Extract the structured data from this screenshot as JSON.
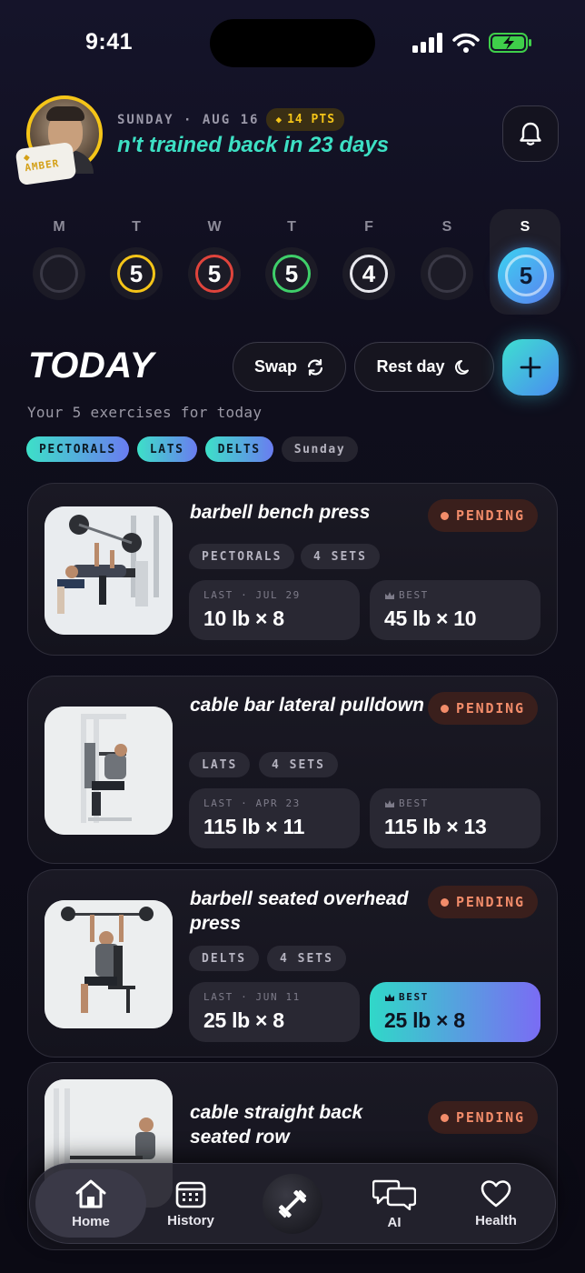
{
  "status": {
    "time": "9:41"
  },
  "header": {
    "avatar_badge": "AMBER",
    "date": "SUNDAY · AUG 16",
    "points": "14 PTS",
    "streak_message": "n't trained back in 23 days"
  },
  "week": [
    {
      "letter": "M",
      "value": "",
      "ring_color": "#3a3946"
    },
    {
      "letter": "T",
      "value": "5",
      "ring_color": "#f5c518"
    },
    {
      "letter": "W",
      "value": "5",
      "ring_color": "#e0443c"
    },
    {
      "letter": "T",
      "value": "5",
      "ring_color": "#3fcf6a"
    },
    {
      "letter": "F",
      "value": "4",
      "ring_color": "#e8e8ee"
    },
    {
      "letter": "S",
      "value": "",
      "ring_color": "#3a3946"
    },
    {
      "letter": "S",
      "value": "5",
      "ring_color": "#ffffff",
      "active": true
    }
  ],
  "today": {
    "title": "TODAY",
    "swap_label": "Swap",
    "rest_label": "Rest day",
    "subtitle": "Your 5 exercises for today",
    "tags": [
      "PECTORALS",
      "LATS",
      "DELTS",
      "Sunday"
    ]
  },
  "exercises": [
    {
      "name": "barbell bench press",
      "status": "PENDING",
      "muscle": "PECTORALS",
      "sets": "4 SETS",
      "last_label": "LAST · JUL 29",
      "last_value": "10 lb × 8",
      "best_label": "BEST",
      "best_value": "45 lb × 10"
    },
    {
      "name": "cable bar lateral pulldown",
      "status": "PENDING",
      "muscle": "LATS",
      "sets": "4 SETS",
      "last_label": "LAST · APR 23",
      "last_value": "115 lb × 11",
      "best_label": "BEST",
      "best_value": "115 lb × 13"
    },
    {
      "name": "barbell seated overhead press",
      "status": "PENDING",
      "muscle": "DELTS",
      "sets": "4 SETS",
      "last_label": "LAST · JUN 11",
      "last_value": "25 lb × 8",
      "best_label": "BEST",
      "best_value": "25 lb × 8"
    },
    {
      "name": "cable straight back seated row",
      "status": "PENDING"
    }
  ],
  "tabbar": {
    "home": "Home",
    "history": "History",
    "ai": "AI",
    "health": "Health"
  },
  "colors": {
    "accent_teal": "#3de0c8",
    "accent_violet": "#6a7cf0",
    "pending": "#f28c6a",
    "points_gold": "#f5c518"
  }
}
